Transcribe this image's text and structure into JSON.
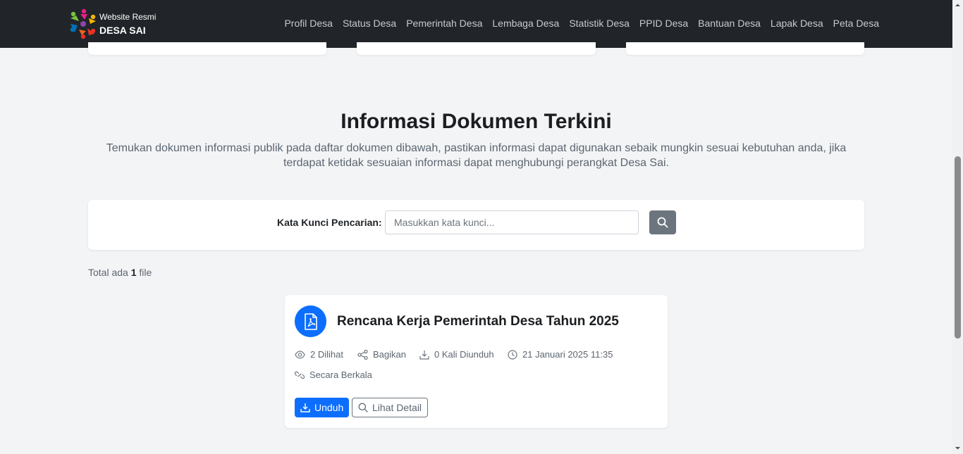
{
  "brand": {
    "subtitle": "Website Resmi",
    "name": "DESA SAI"
  },
  "nav": {
    "items": [
      "Profil Desa",
      "Status Desa",
      "Pemerintah Desa",
      "Lembaga Desa",
      "Statistik Desa",
      "PPID Desa",
      "Bantuan Desa",
      "Lapak Desa",
      "Peta Desa"
    ]
  },
  "section": {
    "title": "Informasi Dokumen Terkini",
    "description": "Temukan dokumen informasi publik pada daftar dokumen dibawah, pastikan informasi dapat digunakan sebaik mungkin sesuai kebutuhan anda, jika terdapat ketidak sesuaian informasi dapat menghubungi perangkat Desa Sai."
  },
  "search": {
    "label": "Kata Kunci Pencarian:",
    "placeholder": "Masukkan kata kunci...",
    "value": ""
  },
  "results": {
    "prefix": "Total ada",
    "count": "1",
    "suffix": "file"
  },
  "document": {
    "title": "Rencana Kerja Pemerintah Desa Tahun 2025",
    "views": "2 Dilihat",
    "share": "Bagikan",
    "downloads": "0 Kali Diunduh",
    "date": "21 Januari 2025 11:35",
    "period": "Secara Berkala",
    "download_label": "Unduh",
    "detail_label": "Lihat Detail",
    "icon": "file-pdf-icon"
  },
  "colors": {
    "navbar": "#212529",
    "primary": "#0d6efd",
    "secondary": "#6c757d",
    "background": "#f3f4f6"
  }
}
